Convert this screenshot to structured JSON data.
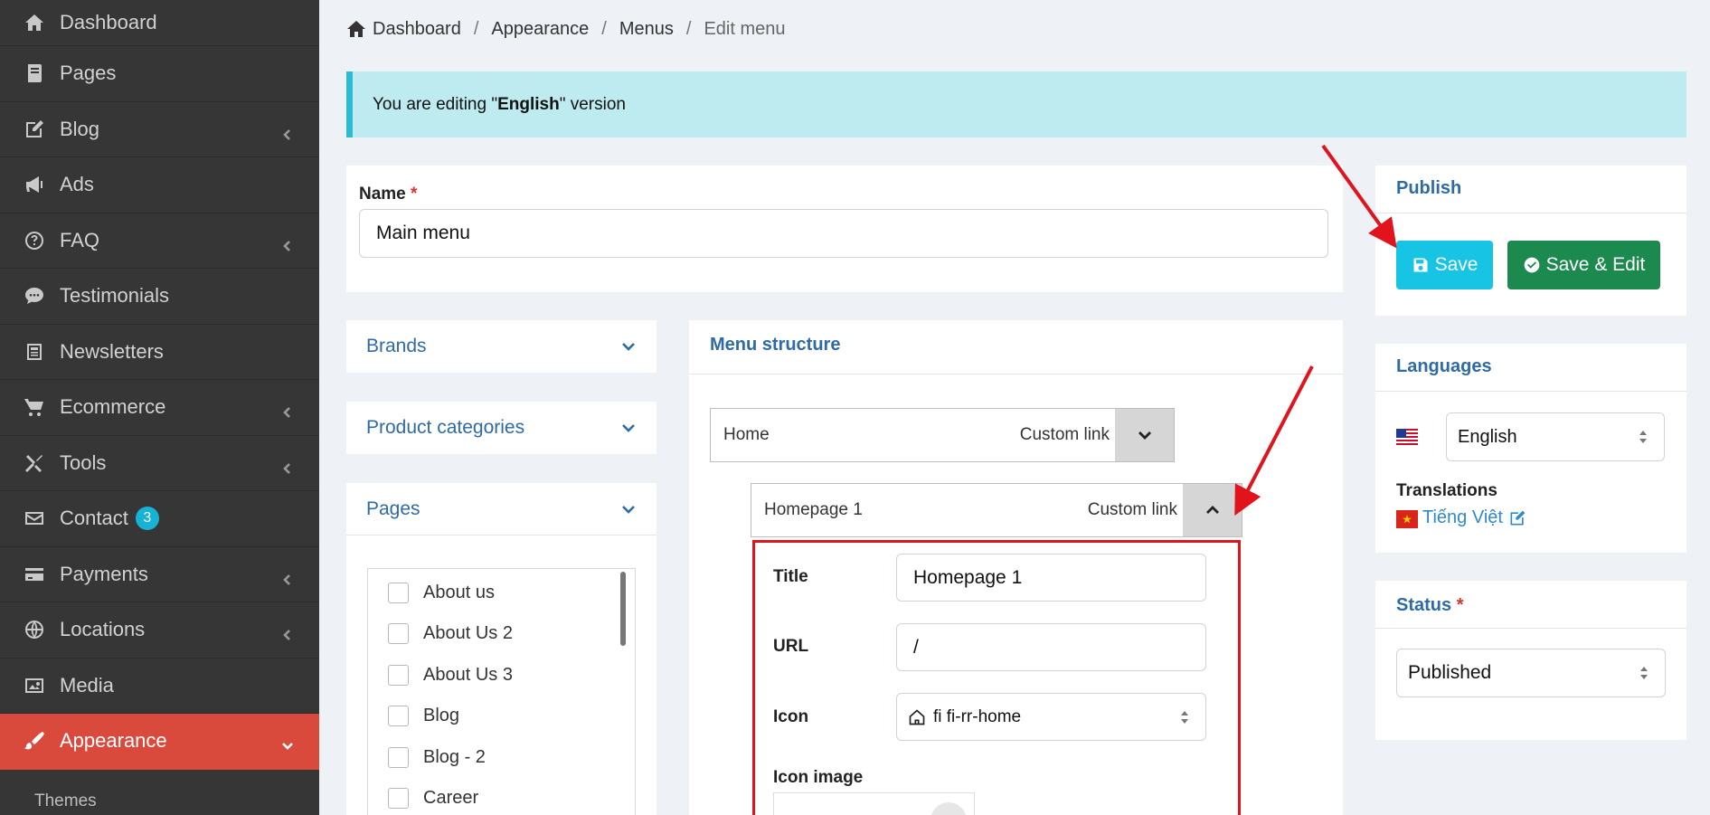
{
  "sidebar": {
    "items": [
      {
        "label": "Dashboard",
        "icon": "home-icon"
      },
      {
        "label": "Pages",
        "icon": "book-icon"
      },
      {
        "label": "Blog",
        "icon": "edit-icon",
        "chevron": true
      },
      {
        "label": "Ads",
        "icon": "bullhorn-icon"
      },
      {
        "label": "FAQ",
        "icon": "question-icon",
        "chevron": true
      },
      {
        "label": "Testimonials",
        "icon": "comment-icon"
      },
      {
        "label": "Newsletters",
        "icon": "newspaper-icon"
      },
      {
        "label": "Ecommerce",
        "icon": "cart-icon",
        "chevron": true
      },
      {
        "label": "Tools",
        "icon": "tools-icon",
        "chevron": true
      },
      {
        "label": "Contact",
        "icon": "envelope-icon",
        "badge": "3"
      },
      {
        "label": "Payments",
        "icon": "credit-card-icon",
        "chevron": true
      },
      {
        "label": "Locations",
        "icon": "globe-icon",
        "chevron": true
      },
      {
        "label": "Media",
        "icon": "image-icon"
      },
      {
        "label": "Appearance",
        "icon": "brush-icon",
        "active": true
      }
    ],
    "sub_item": "Themes"
  },
  "breadcrumb": {
    "items": [
      "Dashboard",
      "Appearance",
      "Menus"
    ],
    "current": "Edit menu",
    "separator": "/"
  },
  "alert": {
    "prefix": "You are editing \"",
    "language": "English",
    "suffix": "\" version"
  },
  "name_field": {
    "label": "Name",
    "required_mark": "*",
    "value": "Main menu"
  },
  "accordions": {
    "brands": "Brands",
    "product_categories": "Product categories",
    "pages": "Pages"
  },
  "pages_list": [
    "About us",
    "About Us 2",
    "About Us 3",
    "Blog",
    "Blog - 2",
    "Career"
  ],
  "menu_structure": {
    "title": "Menu structure",
    "items": [
      {
        "name": "Home",
        "type": "Custom link"
      },
      {
        "name": "Homepage 1",
        "type": "Custom link"
      }
    ],
    "edit_form": {
      "title_label": "Title",
      "title_value": "Homepage 1",
      "url_label": "URL",
      "url_value": "/",
      "icon_label": "Icon",
      "icon_value": "fi fi-rr-home",
      "icon_image_label": "Icon image"
    }
  },
  "publish": {
    "title": "Publish",
    "save_label": "Save",
    "save_edit_label": "Save & Edit"
  },
  "languages": {
    "title": "Languages",
    "selected": "English",
    "translations_label": "Translations",
    "translation_link": "Tiếng Việt"
  },
  "status": {
    "title": "Status",
    "required_mark": "*",
    "selected": "Published"
  },
  "colors": {
    "accent": "#2e6ba5",
    "sidebar_bg": "#363636",
    "active": "#d9493c",
    "save": "#17c4e3",
    "save_edit": "#1c8a4e",
    "highlight": "#e1141e"
  }
}
